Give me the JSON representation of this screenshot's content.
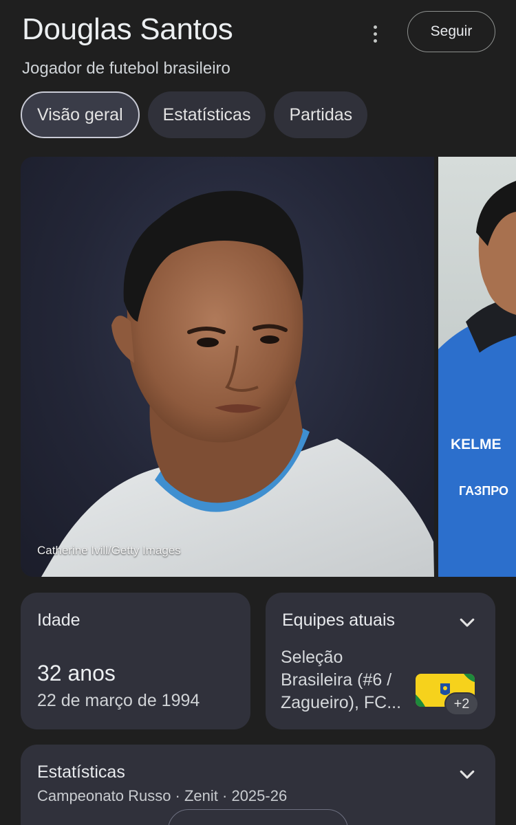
{
  "header": {
    "title": "Douglas Santos",
    "subtitle": "Jogador de futebol brasileiro",
    "follow_label": "Seguir"
  },
  "tabs": [
    {
      "label": "Visão geral",
      "active": true
    },
    {
      "label": "Estatísticas",
      "active": false
    },
    {
      "label": "Partidas",
      "active": false
    }
  ],
  "gallery": {
    "credit": "Catherine Ivill/Getty Images"
  },
  "age_card": {
    "label": "Idade",
    "value": "32 anos",
    "birthdate": "22 de março de 1994"
  },
  "teams_card": {
    "label": "Equipes atuais",
    "team_text": "Seleção Brasileira (#6 / Zagueiro), FC...",
    "more_count": "+2"
  },
  "stats_card": {
    "label": "Estatísticas",
    "subtitle": "Campeonato Russo · Zenit · 2025-26"
  },
  "icons": {
    "more": "more-vert-icon",
    "chevron": "chevron-down-icon"
  },
  "colors": {
    "background": "#1f1f1f",
    "card": "#30313b",
    "tab_active": "#3a3c48"
  }
}
